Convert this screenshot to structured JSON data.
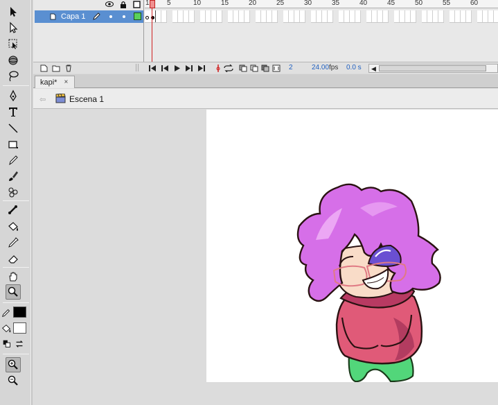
{
  "timeline": {
    "layer_name": "Capa 1",
    "ruler_ticks": [
      "1",
      "5",
      "10",
      "15",
      "20",
      "25",
      "30",
      "35",
      "40",
      "45",
      "50",
      "55",
      "60"
    ],
    "current_frame": "2",
    "fps_value": "24.00",
    "fps_label": "fps",
    "elapsed_time": "0.0 s"
  },
  "document": {
    "tab_label": "kapi*",
    "close_glyph": "×",
    "scene_label": "Escena 1"
  },
  "toolbar": {
    "stroke_color": "#000000",
    "fill_color": "#ffffff",
    "tools": [
      "selection-tool-icon",
      "subselection-tool-icon",
      "free-transform-tool-icon",
      "3d-rotation-tool-icon",
      "lasso-tool-icon",
      "pen-tool-icon",
      "text-tool-icon",
      "line-tool-icon",
      "rectangle-tool-icon",
      "pencil-tool-icon",
      "brush-tool-icon",
      "deco-tool-icon",
      "bone-tool-icon",
      "paint-bucket-tool-icon",
      "eyedropper-tool-icon",
      "eraser-tool-icon",
      "hand-tool-icon",
      "zoom-tool-icon"
    ]
  },
  "colors": {
    "layer_highlight": "#5a8fd1",
    "playhead": "#d02020",
    "fps_text": "#2060c0",
    "hair": "#d66fe8",
    "sweater": "#e05a78",
    "pants": "#52d67a"
  }
}
